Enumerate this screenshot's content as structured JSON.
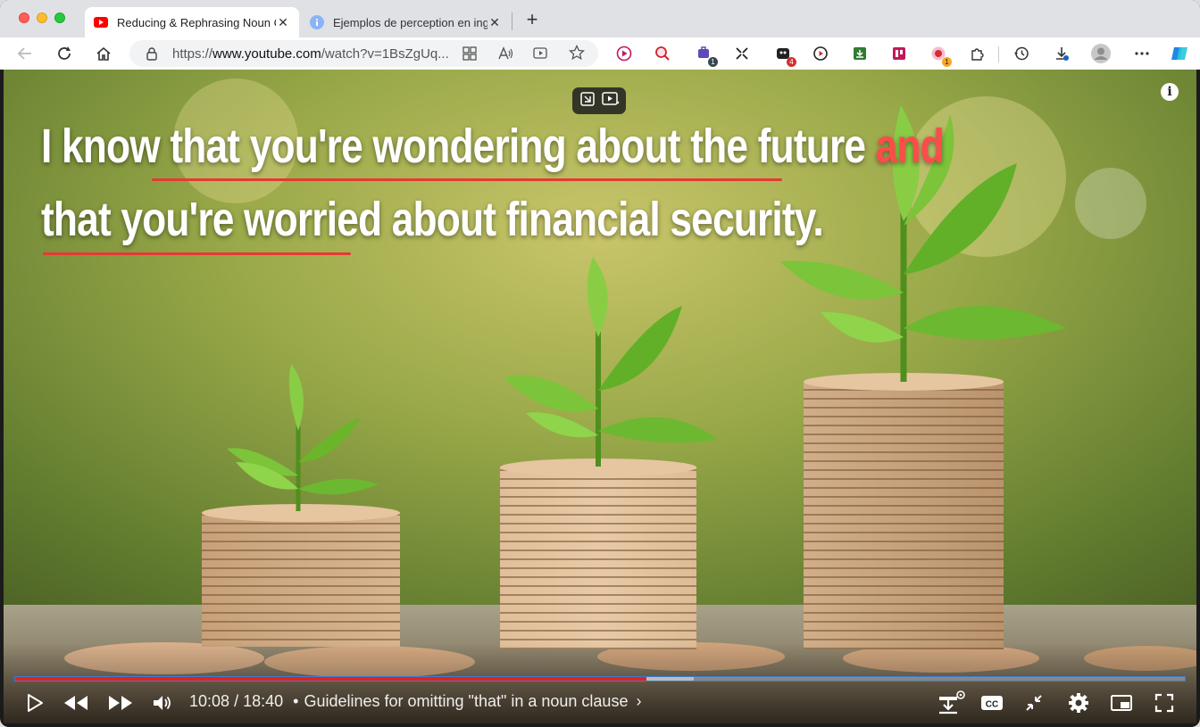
{
  "browser": {
    "tabs": [
      {
        "title": "Reducing & Rephrasing Noun C",
        "active": true,
        "favicon": "youtube-icon"
      },
      {
        "title": "Ejemplos de perception en ingl",
        "active": false,
        "favicon": "info-icon"
      }
    ],
    "url_prefix": "https://",
    "url_host": "www.youtube.com",
    "url_path": "/watch?v=1BsZgUq...",
    "extension_badges": {
      "ext1": "1",
      "ext2": "4",
      "ext3": "1"
    },
    "colors": {
      "accent": "#e62117",
      "brand": "#ff0000"
    }
  },
  "video": {
    "caption_line1": {
      "pre": "I know that you're wondering about the future ",
      "highlight": "and"
    },
    "caption_line2": "that you're worried about financial security.",
    "current_time": "10:08",
    "duration": "18:40",
    "time_separator": "/",
    "chapter": "Guidelines for omitting \"that\" in a noun clause",
    "chapter_chevron": "›",
    "progress_fraction": 0.54,
    "buffer_fraction": 0.58
  }
}
